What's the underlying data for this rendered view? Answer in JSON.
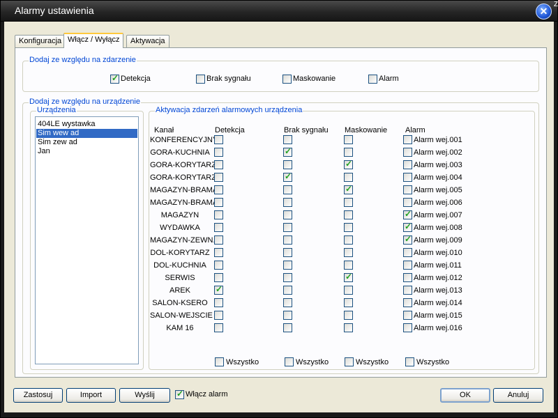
{
  "window": {
    "title": "Alarmy ustawienia"
  },
  "tabs": [
    {
      "label": "Konfiguracja",
      "active": false
    },
    {
      "label": "Włącz / Wyłącz",
      "active": true
    },
    {
      "label": "Aktywacja",
      "active": false
    }
  ],
  "event_group": {
    "legend": "Dodaj ze względu na zdarzenie",
    "options": [
      {
        "label": "Detekcja",
        "checked": true
      },
      {
        "label": "Brak sygnału",
        "checked": false
      },
      {
        "label": "Maskowanie",
        "checked": false
      },
      {
        "label": "Alarm",
        "checked": false
      }
    ]
  },
  "device_group": {
    "legend": "Dodaj ze względu na urządzenie"
  },
  "devices": {
    "legend": "Urządzenia",
    "items": [
      "404LE wystawka",
      "Sim wew ad",
      "Sim zew ad",
      "Jan"
    ],
    "selected_index": 1
  },
  "activation": {
    "legend": "Aktywacja zdarzeń alarmowych urządzenia",
    "headers": {
      "channel": "Kanał",
      "detection": "Detekcja",
      "signal_loss": "Brak sygnału",
      "masking": "Maskowanie",
      "alarm": "Alarm"
    },
    "rows": [
      {
        "channel": "KONFERENCYJNY",
        "detection": false,
        "signal_loss": false,
        "masking": false,
        "alarm": false,
        "alarm_label": "Alarm wej.001"
      },
      {
        "channel": "GORA-KUCHNIA",
        "detection": false,
        "signal_loss": true,
        "masking": false,
        "alarm": false,
        "alarm_label": "Alarm wej.002"
      },
      {
        "channel": "GORA-KORYTARZ",
        "detection": false,
        "signal_loss": false,
        "masking": true,
        "alarm": false,
        "alarm_label": "Alarm wej.003"
      },
      {
        "channel": "GORA-KORYTARZ",
        "detection": false,
        "signal_loss": true,
        "masking": false,
        "alarm": false,
        "alarm_label": "Alarm wej.004"
      },
      {
        "channel": "MAGAZYN-BRAMA",
        "detection": false,
        "signal_loss": false,
        "masking": true,
        "alarm": false,
        "alarm_label": "Alarm wej.005"
      },
      {
        "channel": "MAGAZYN-BRAMA",
        "detection": false,
        "signal_loss": false,
        "masking": false,
        "alarm": false,
        "alarm_label": "Alarm wej.006"
      },
      {
        "channel": "MAGAZYN",
        "detection": false,
        "signal_loss": false,
        "masking": false,
        "alarm": true,
        "alarm_label": "Alarm wej.007"
      },
      {
        "channel": "WYDAWKA",
        "detection": false,
        "signal_loss": false,
        "masking": false,
        "alarm": true,
        "alarm_label": "Alarm wej.008"
      },
      {
        "channel": "MAGAZYN-ZEWN.",
        "detection": false,
        "signal_loss": false,
        "masking": false,
        "alarm": true,
        "alarm_label": "Alarm wej.009"
      },
      {
        "channel": "DOL-KORYTARZ",
        "detection": false,
        "signal_loss": false,
        "masking": false,
        "alarm": false,
        "alarm_label": "Alarm wej.010"
      },
      {
        "channel": "DOL-KUCHNIA",
        "detection": false,
        "signal_loss": false,
        "masking": false,
        "alarm": false,
        "alarm_label": "Alarm wej.011"
      },
      {
        "channel": "SERWIS",
        "detection": false,
        "signal_loss": false,
        "masking": true,
        "alarm": false,
        "alarm_label": "Alarm wej.012"
      },
      {
        "channel": "AREK",
        "detection": true,
        "signal_loss": false,
        "masking": false,
        "alarm": false,
        "alarm_label": "Alarm wej.013"
      },
      {
        "channel": "SALON-KSERO",
        "detection": false,
        "signal_loss": false,
        "masking": false,
        "alarm": false,
        "alarm_label": "Alarm wej.014"
      },
      {
        "channel": "SALON-WEJSCIE",
        "detection": false,
        "signal_loss": false,
        "masking": false,
        "alarm": false,
        "alarm_label": "Alarm wej.015"
      },
      {
        "channel": "KAM 16",
        "detection": false,
        "signal_loss": false,
        "masking": false,
        "alarm": false,
        "alarm_label": "Alarm wej.016"
      }
    ],
    "select_all_label": "Wszystko"
  },
  "footer": {
    "apply_label": "Zastosuj",
    "import_label": "Import",
    "send_label": "Wyślij",
    "enable_alarm_label": "Włącz alarm",
    "enable_alarm_checked": true,
    "ok_label": "OK",
    "cancel_label": "Anuluj"
  }
}
